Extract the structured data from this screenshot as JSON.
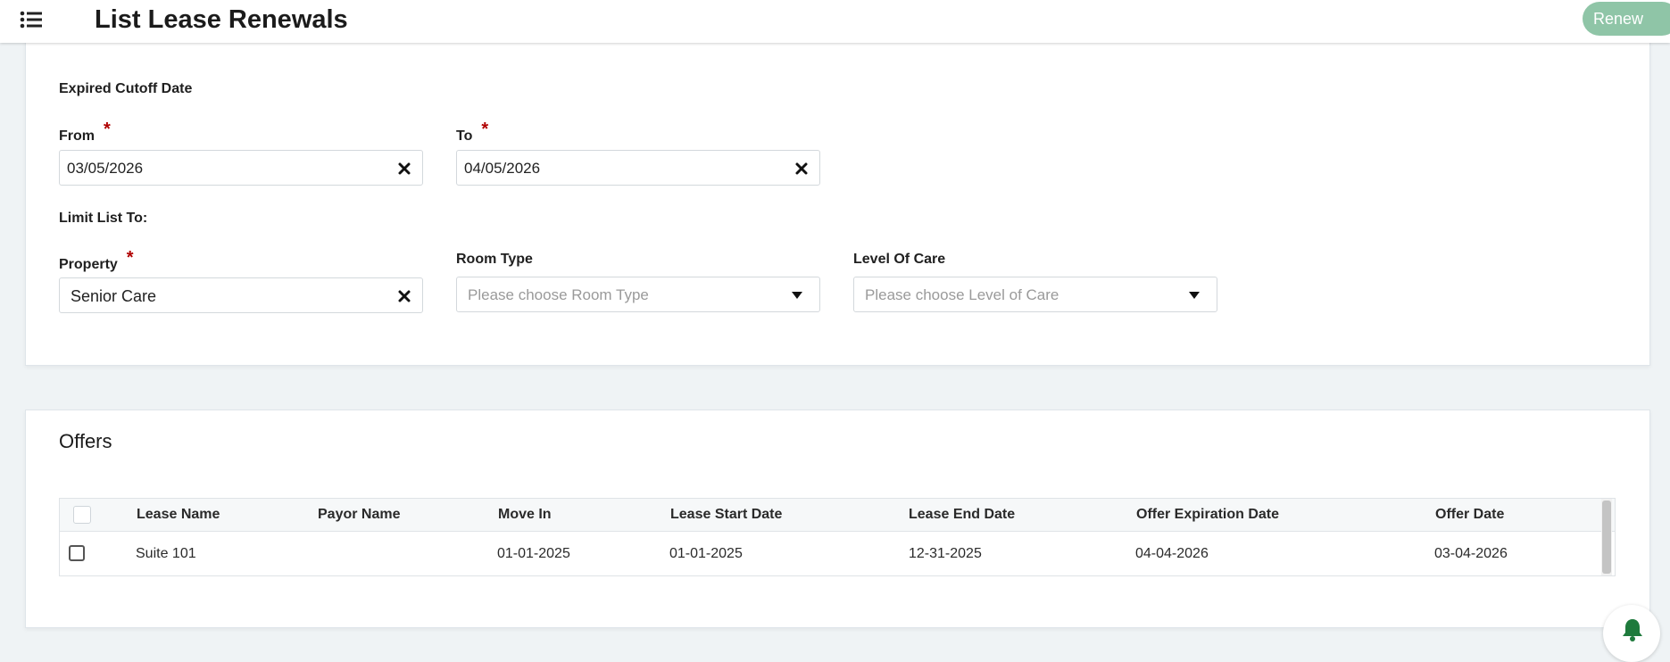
{
  "header": {
    "title": "List Lease Renewals",
    "renew_label": "Renew",
    "menu_icon": "menu-list-icon"
  },
  "filters": {
    "section_title": "Expired Cutoff Date",
    "from": {
      "label": "From",
      "required_mark": "*",
      "value": "03/05/2026"
    },
    "to": {
      "label": "To",
      "required_mark": "*",
      "value": "04/05/2026"
    },
    "limit_title": "Limit List To:",
    "property": {
      "label": "Property",
      "required_mark": "*",
      "value": "Senior Care"
    },
    "room_type": {
      "label": "Room Type",
      "placeholder": "Please choose Room Type"
    },
    "level_of_care": {
      "label": "Level Of Care",
      "placeholder": "Please choose Level of Care"
    }
  },
  "offers": {
    "title": "Offers",
    "columns": [
      "Lease Name",
      "Payor Name",
      "Move In",
      "Lease Start Date",
      "Lease End Date",
      "Offer Expiration Date",
      "Offer Date"
    ],
    "rows": [
      {
        "lease_name": "Suite 101",
        "payor_name": "",
        "move_in": "01-01-2025",
        "lease_start": "01-01-2025",
        "lease_end": "12-31-2025",
        "offer_expiration": "04-04-2026",
        "offer_date": "03-04-2026"
      }
    ]
  },
  "colors": {
    "accent_green": "#8fc5a7",
    "bell_green": "#1e7a3c",
    "required_red": "#b00000"
  }
}
